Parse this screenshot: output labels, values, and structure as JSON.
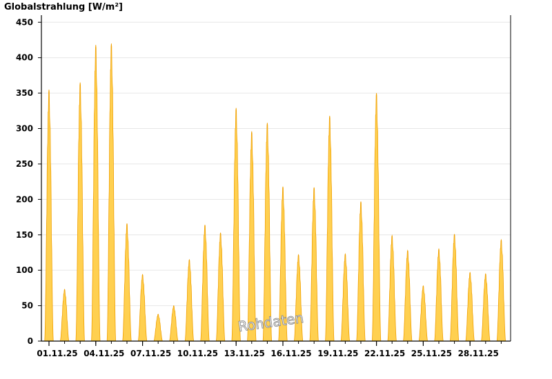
{
  "chart_data": {
    "type": "area",
    "ylabel": "Globalstrahlung [W/m²]",
    "ylim": [
      0,
      460
    ],
    "y_ticks": [
      0,
      50,
      100,
      150,
      200,
      250,
      300,
      350,
      400,
      450
    ],
    "x_tick_labels": [
      "01.11.25",
      "04.11.25",
      "07.11.25",
      "10.11.25",
      "13.11.25",
      "16.11.25",
      "19.11.25",
      "22.11.25",
      "25.11.25",
      "28.11.25"
    ],
    "grid": "horizontal",
    "series": [
      {
        "daily_peaks": [
          {
            "date": "01.11.25",
            "value": 355
          },
          {
            "date": "02.11.25",
            "value": 73
          },
          {
            "date": "03.11.25",
            "value": 365
          },
          {
            "date": "04.11.25",
            "value": 418
          },
          {
            "date": "05.11.25",
            "value": 420
          },
          {
            "date": "06.11.25",
            "value": 166
          },
          {
            "date": "07.11.25",
            "value": 94
          },
          {
            "date": "08.11.25",
            "value": 38
          },
          {
            "date": "09.11.25",
            "value": 50
          },
          {
            "date": "10.11.25",
            "value": 115
          },
          {
            "date": "11.11.25",
            "value": 164
          },
          {
            "date": "12.11.25",
            "value": 153
          },
          {
            "date": "13.11.25",
            "value": 329
          },
          {
            "date": "14.11.25",
            "value": 296
          },
          {
            "date": "15.11.25",
            "value": 308
          },
          {
            "date": "16.11.25",
            "value": 218
          },
          {
            "date": "17.11.25",
            "value": 122
          },
          {
            "date": "18.11.25",
            "value": 217
          },
          {
            "date": "19.11.25",
            "value": 318
          },
          {
            "date": "20.11.25",
            "value": 123
          },
          {
            "date": "21.11.25",
            "value": 197
          },
          {
            "date": "22.11.25",
            "value": 350
          },
          {
            "date": "23.11.25",
            "value": 149
          },
          {
            "date": "24.11.25",
            "value": 128
          },
          {
            "date": "25.11.25",
            "value": 78
          },
          {
            "date": "26.11.25",
            "value": 130
          },
          {
            "date": "27.11.25",
            "value": 151
          },
          {
            "date": "28.11.25",
            "value": 97
          },
          {
            "date": "29.11.25",
            "value": 95
          },
          {
            "date": "30.11.25",
            "value": 143
          }
        ]
      }
    ],
    "colors": {
      "fill": "#ffd050",
      "stroke": "#f0a000",
      "grid": "#e6e6e6",
      "axis": "#000000"
    }
  },
  "watermark": "Rohdaten"
}
